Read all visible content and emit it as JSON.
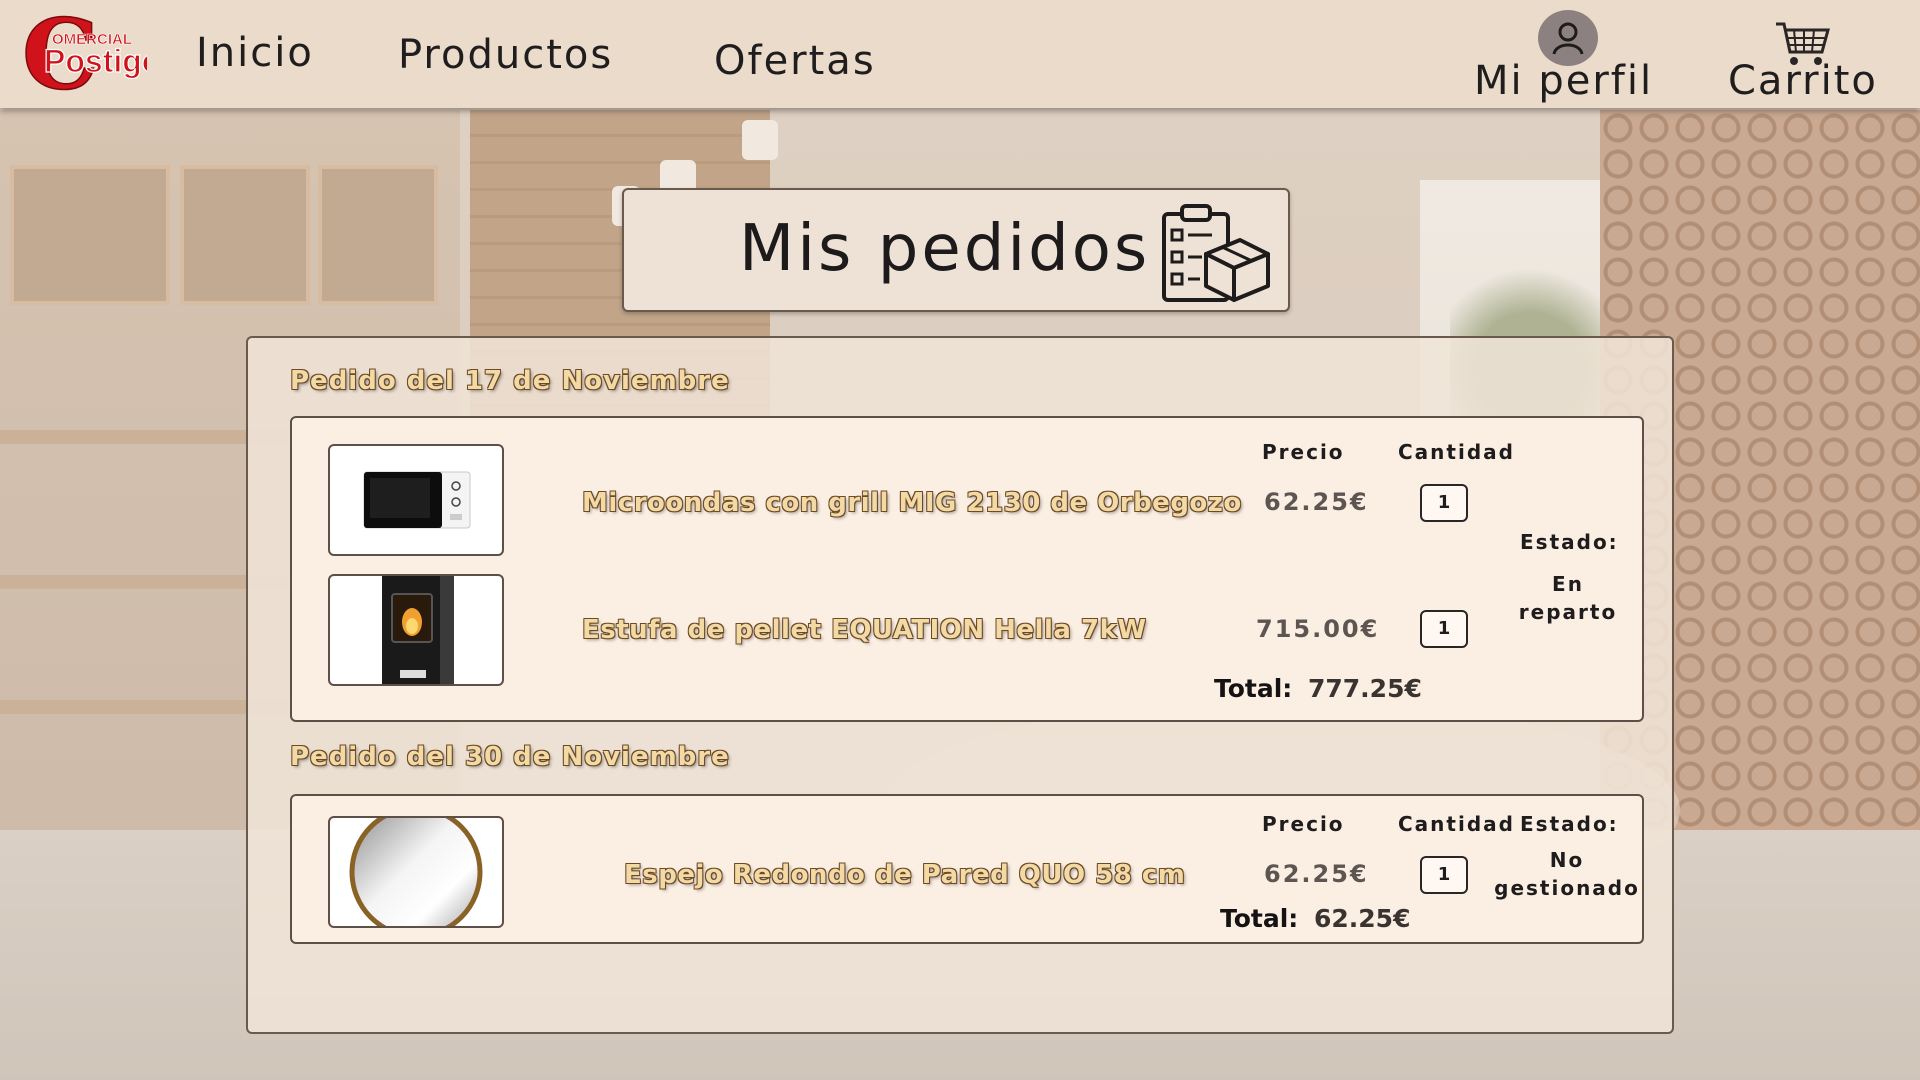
{
  "brand": {
    "line1": "OMERCIAL",
    "line2": "Postigo",
    "initial": "C"
  },
  "nav": {
    "inicio": "Inicio",
    "productos": "Productos",
    "ofertas": "Ofertas",
    "perfil": "Mi perfil",
    "carrito": "Carrito"
  },
  "page_title": "Mis pedidos",
  "orders": [
    {
      "heading": "Pedido del 17 de Noviembre",
      "price_header": "Precio",
      "qty_header": "Cantidad",
      "status_label": "Estado:",
      "status_value": "En reparto",
      "items": [
        {
          "name": "Microondas con grill MIG 2130 de Orbegozo",
          "price": "62.25€",
          "qty": "1",
          "image": "microwave-image"
        },
        {
          "name": "Estufa de pellet EQUATION Hella 7kW",
          "price": "715.00€",
          "qty": "1",
          "image": "pellet-stove-image"
        }
      ],
      "total_label": "Total:",
      "total_value": "777.25€"
    },
    {
      "heading": "Pedido del 30 de Noviembre",
      "price_header": "Precio",
      "qty_header": "Cantidad",
      "status_label": "Estado:",
      "status_value": "No gestionado",
      "items": [
        {
          "name": "Espejo Redondo de Pared QUO 58 cm",
          "price": "62.25€",
          "qty": "1",
          "image": "round-mirror-image"
        }
      ],
      "total_label": "Total:",
      "total_value": "62.25€"
    }
  ],
  "colors": {
    "header_bg": "#eadbca",
    "panel_bg": "#f0e4d7",
    "card_bg": "#fbeee3",
    "item_name_fill": "#f3d9a4",
    "item_name_outline": "#6b4a28",
    "brand_red": "#d0121b"
  }
}
